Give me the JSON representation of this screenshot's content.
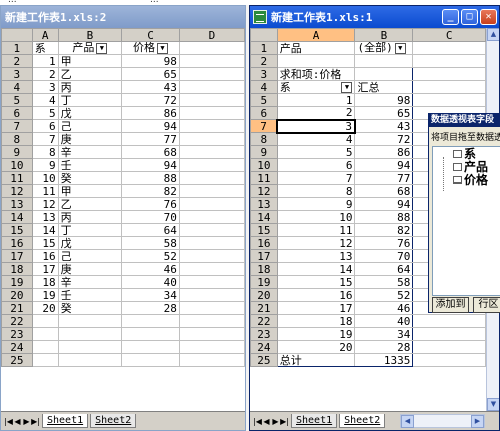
{
  "top_strip": {
    "text_left": "...",
    "text_right": "..."
  },
  "window1": {
    "title": "新建工作表1.xls:2",
    "columns": [
      "A",
      "B",
      "C",
      "D"
    ],
    "rows": [
      {
        "n": "1",
        "a": "系",
        "b": "产品",
        "c": "价格"
      },
      {
        "n": "2",
        "a": "1",
        "b": "甲",
        "c": "98"
      },
      {
        "n": "3",
        "a": "2",
        "b": "乙",
        "c": "65"
      },
      {
        "n": "4",
        "a": "3",
        "b": "丙",
        "c": "43"
      },
      {
        "n": "5",
        "a": "4",
        "b": "丁",
        "c": "72"
      },
      {
        "n": "6",
        "a": "5",
        "b": "戊",
        "c": "86"
      },
      {
        "n": "7",
        "a": "6",
        "b": "己",
        "c": "94"
      },
      {
        "n": "8",
        "a": "7",
        "b": "庚",
        "c": "77"
      },
      {
        "n": "9",
        "a": "8",
        "b": "辛",
        "c": "68"
      },
      {
        "n": "10",
        "a": "9",
        "b": "壬",
        "c": "94"
      },
      {
        "n": "11",
        "a": "10",
        "b": "癸",
        "c": "88"
      },
      {
        "n": "12",
        "a": "11",
        "b": "甲",
        "c": "82"
      },
      {
        "n": "13",
        "a": "12",
        "b": "乙",
        "c": "76"
      },
      {
        "n": "14",
        "a": "13",
        "b": "丙",
        "c": "70"
      },
      {
        "n": "15",
        "a": "14",
        "b": "丁",
        "c": "64"
      },
      {
        "n": "16",
        "a": "15",
        "b": "戊",
        "c": "58"
      },
      {
        "n": "17",
        "a": "16",
        "b": "己",
        "c": "52"
      },
      {
        "n": "18",
        "a": "17",
        "b": "庚",
        "c": "46"
      },
      {
        "n": "19",
        "a": "18",
        "b": "辛",
        "c": "40"
      },
      {
        "n": "20",
        "a": "19",
        "b": "壬",
        "c": "34"
      },
      {
        "n": "21",
        "a": "20",
        "b": "癸",
        "c": "28"
      },
      {
        "n": "22",
        "a": "",
        "b": "",
        "c": ""
      },
      {
        "n": "23",
        "a": "",
        "b": "",
        "c": ""
      },
      {
        "n": "24",
        "a": "",
        "b": "",
        "c": ""
      },
      {
        "n": "25",
        "a": "",
        "b": "",
        "c": ""
      }
    ],
    "tabs": [
      "Sheet1",
      "Sheet2"
    ]
  },
  "window2": {
    "title": "新建工作表1.xls:1",
    "columns": [
      "A",
      "B",
      "C"
    ],
    "page_field": {
      "label": "产品",
      "value": "(全部)"
    },
    "data_label": "求和项:价格",
    "row_header": "系",
    "total_header": "汇总",
    "pivot_rows": [
      {
        "n": "5",
        "a": "1",
        "b": "98"
      },
      {
        "n": "6",
        "a": "2",
        "b": "65"
      },
      {
        "n": "7",
        "a": "3",
        "b": "43"
      },
      {
        "n": "8",
        "a": "4",
        "b": "72"
      },
      {
        "n": "9",
        "a": "5",
        "b": "86"
      },
      {
        "n": "10",
        "a": "6",
        "b": "94"
      },
      {
        "n": "11",
        "a": "7",
        "b": "77"
      },
      {
        "n": "12",
        "a": "8",
        "b": "68"
      },
      {
        "n": "13",
        "a": "9",
        "b": "94"
      },
      {
        "n": "14",
        "a": "10",
        "b": "88"
      },
      {
        "n": "15",
        "a": "11",
        "b": "82"
      },
      {
        "n": "16",
        "a": "12",
        "b": "76"
      },
      {
        "n": "17",
        "a": "13",
        "b": "70"
      },
      {
        "n": "18",
        "a": "14",
        "b": "64"
      },
      {
        "n": "19",
        "a": "15",
        "b": "58"
      },
      {
        "n": "20",
        "a": "16",
        "b": "52"
      },
      {
        "n": "21",
        "a": "17",
        "b": "46"
      },
      {
        "n": "22",
        "a": "18",
        "b": "40"
      },
      {
        "n": "23",
        "a": "19",
        "b": "34"
      },
      {
        "n": "24",
        "a": "20",
        "b": "28"
      }
    ],
    "total_row": {
      "n": "25",
      "label": "总计",
      "value": "1335"
    },
    "tabs": [
      "Sheet1",
      "Sheet2"
    ]
  },
  "pivot_panel": {
    "title": "数据透视表字段",
    "subtitle": "将项目拖至数据透",
    "fields": [
      "系",
      "产品",
      "价格"
    ],
    "add_button": "添加到",
    "area_button": "行区"
  },
  "colors": {
    "selection": "#ffc083",
    "active_title": "#0b4bd0",
    "inactive_title": "#7f9bc9"
  }
}
